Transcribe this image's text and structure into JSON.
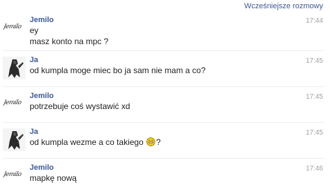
{
  "header": {
    "earlier_link": "Wcześniejsze rozmowy"
  },
  "messages": [
    {
      "author": "Jemilo",
      "avatar_text": "Jemilo",
      "time": "17:44",
      "lines": [
        "ey",
        "masz konto na mpc ?"
      ]
    },
    {
      "author": "Ja",
      "time": "17:45",
      "lines": [
        "od kumpla moge miec bo ja sam nie mam a co?"
      ]
    },
    {
      "author": "Jemilo",
      "avatar_text": "Jemilo",
      "time": "17:45",
      "lines": [
        "potrzebuje coś wystawić xd"
      ]
    },
    {
      "author": "Ja",
      "time": "17:45",
      "lines_with_emoticon": {
        "before": "od kumpla wezme a co takiego ",
        "emoticon": "grin-icon",
        "after": "?"
      }
    },
    {
      "author": "Jemilo",
      "avatar_text": "Jemilo",
      "time": "17:46",
      "lines": [
        "mapkę nową"
      ]
    }
  ],
  "colors": {
    "author_blue": "#3b5998",
    "timestamp_gray": "#a0a0a0",
    "divider": "#eceff5",
    "emoticon_yellow": "#f5d21c"
  }
}
